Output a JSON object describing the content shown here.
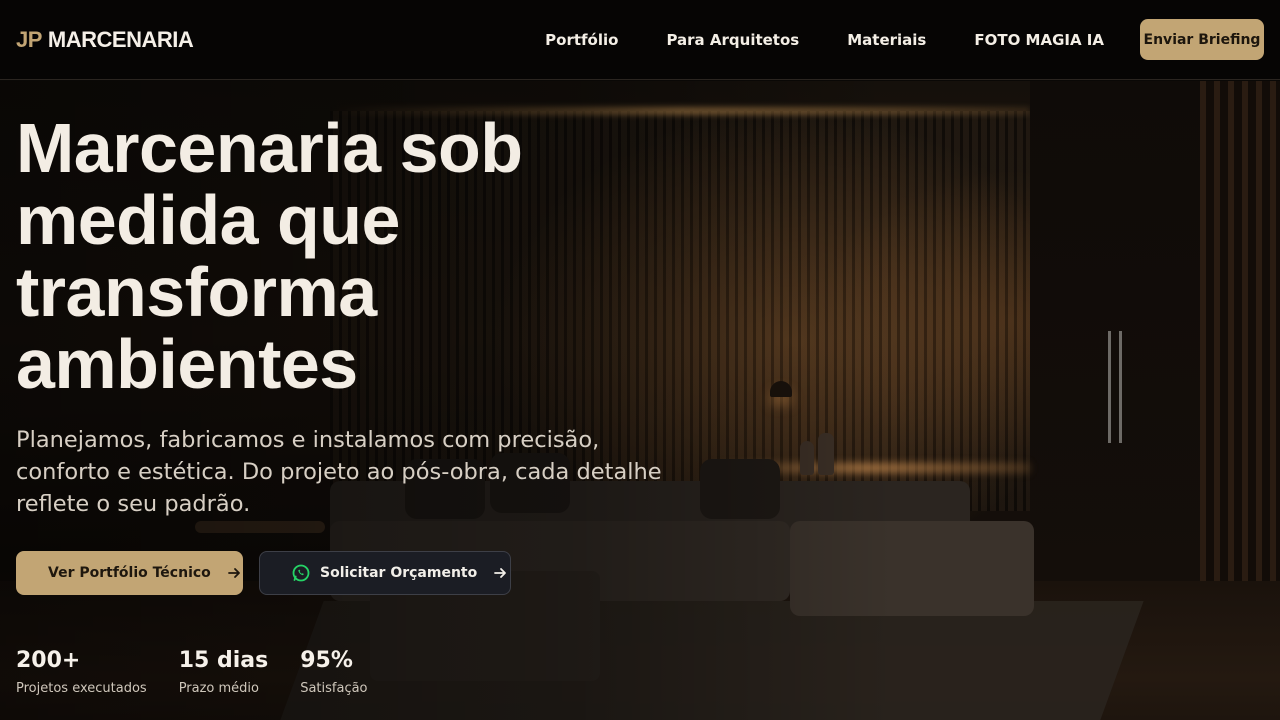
{
  "brand": {
    "prefix": "JP",
    "name": "MARCENARIA",
    "accent_color": "#c2a574"
  },
  "nav": {
    "items": [
      {
        "label": "Portfólio"
      },
      {
        "label": "Para Arquitetos"
      },
      {
        "label": "Materiais"
      },
      {
        "label": "FOTO MAGIA IA"
      }
    ],
    "cta_label": "Enviar Briefing"
  },
  "hero": {
    "headline": "Marcenaria sob medida que transforma ambientes",
    "subtitle": "Planejamos, fabricamos e instalamos com precisão, conforto e estética. Do projeto ao pós-obra, cada detalhe reflete o seu padrão.",
    "primary_button": {
      "label": "Ver Portfólio Técnico",
      "icon": "arrow-right-icon"
    },
    "secondary_button": {
      "label": "Solicitar Orçamento",
      "icon": "whatsapp-icon",
      "trailing_icon": "arrow-right-icon"
    },
    "background": "dark living room with wooden slat wall and beige sectional sofa"
  },
  "stats": [
    {
      "value": "200+",
      "label": "Projetos executados"
    },
    {
      "value": "15 dias",
      "label": "Prazo médio"
    },
    {
      "value": "95%",
      "label": "Satisfação"
    }
  ]
}
